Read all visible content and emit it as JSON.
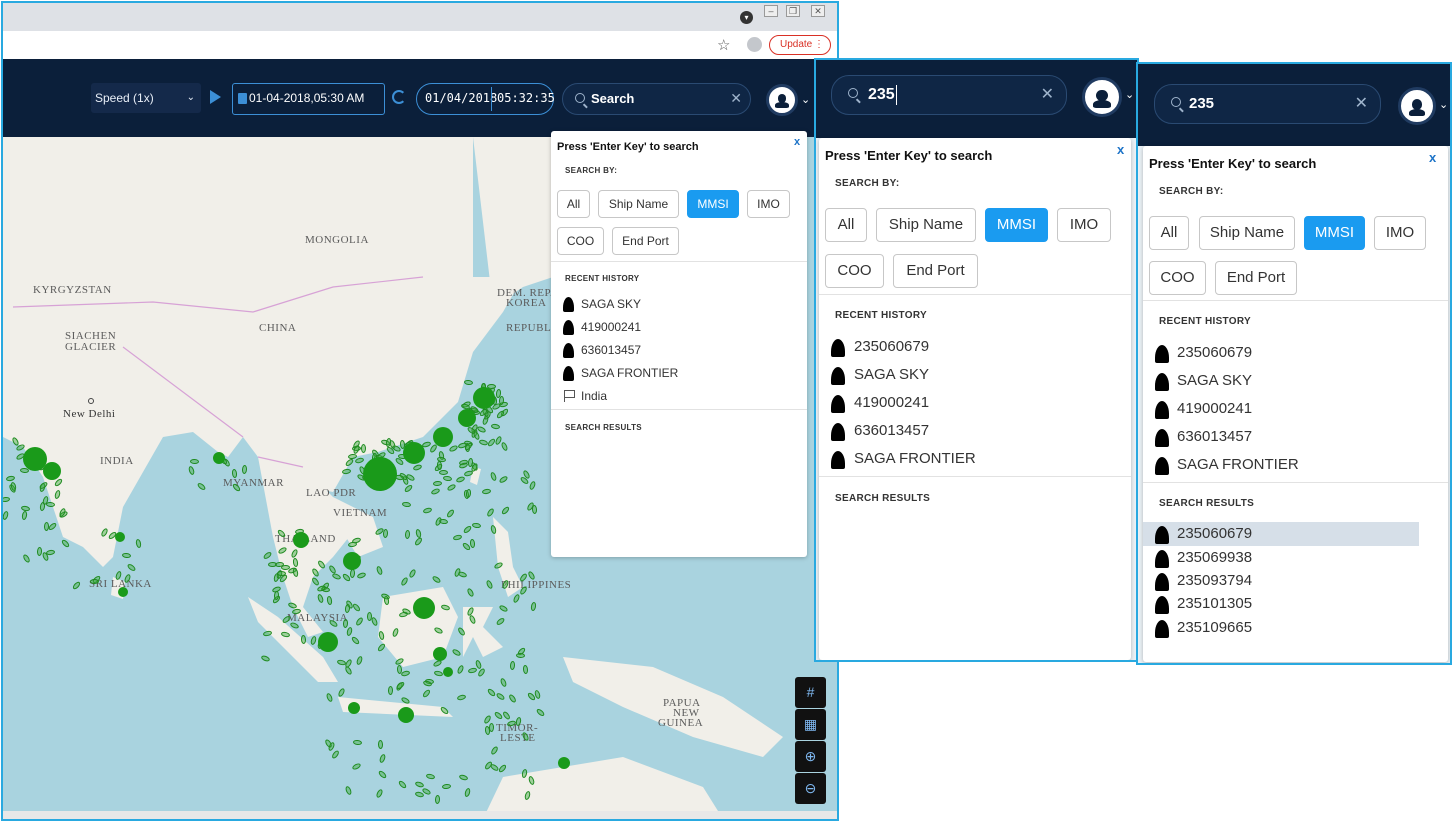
{
  "browser": {
    "update_label": "Update",
    "update_color": "#d93025",
    "icons": [
      "star-icon",
      "profile-icon",
      "tab-menu-icon",
      "minimize-icon",
      "restore-icon",
      "close-icon"
    ]
  },
  "toolbar": {
    "speed": "Speed (1x)",
    "date_value": "01-04-2018,05:30 AM",
    "clock_date": "01/04/2018",
    "clock_time": "05:32:35",
    "search_placeholder": "Search",
    "accent": "#3c8fd6",
    "bar_color": "#0b1f3a"
  },
  "map": {
    "labels": [
      "MONGOLIA",
      "KYRGYZSTAN",
      "SIACHEN",
      "GLACIER",
      "CHINA",
      "DEM. REP.",
      "KOREA",
      "REPUBLIC",
      "New Delhi",
      "INDIA",
      "MYANMAR",
      "LAO PDR",
      "VIETNAM",
      "THAILAND",
      "SRI LANKA",
      "PHILIPPINES",
      "MALAYSIA",
      "PAPUA",
      "NEW",
      "GUINEA",
      "TIMOR-",
      "LESTE"
    ],
    "controls": [
      "grid-icon",
      "map-layer-icon",
      "zoom-in-icon",
      "zoom-out-icon"
    ],
    "vessel_color": "#1a9a1a"
  },
  "panel1": {
    "prompt": "Press 'Enter Key' to search",
    "close": "x",
    "search_by": "SEARCH BY:",
    "filters": [
      "All",
      "Ship Name",
      "MMSI",
      "IMO",
      "COO",
      "End Port"
    ],
    "active_filter": "MMSI",
    "recent_title": "RECENT HISTORY",
    "recent": [
      "SAGA SKY",
      "419000241",
      "636013457",
      "SAGA FRONTIER",
      "India"
    ],
    "results_title": "SEARCH RESULTS"
  },
  "panel2": {
    "query": "235",
    "prompt": "Press 'Enter Key' to search",
    "close": "x",
    "search_by": "SEARCH BY:",
    "filters": [
      "All",
      "Ship Name",
      "MMSI",
      "IMO",
      "COO",
      "End Port"
    ],
    "active_filter": "MMSI",
    "recent_title": "RECENT HISTORY",
    "recent": [
      "235060679",
      "SAGA SKY",
      "419000241",
      "636013457",
      "SAGA FRONTIER"
    ],
    "results_title": "SEARCH RESULTS"
  },
  "panel3": {
    "query": "235",
    "prompt": "Press 'Enter Key' to search",
    "close": "x",
    "search_by": "SEARCH BY:",
    "filters": [
      "All",
      "Ship Name",
      "MMSI",
      "IMO",
      "COO",
      "End Port"
    ],
    "active_filter": "MMSI",
    "recent_title": "RECENT HISTORY",
    "recent": [
      "235060679",
      "SAGA SKY",
      "419000241",
      "636013457",
      "SAGA FRONTIER"
    ],
    "results_title": "SEARCH RESULTS",
    "results": [
      "235060679",
      "235069938",
      "235093794",
      "235101305",
      "235109665"
    ],
    "highlighted_result": "235060679"
  },
  "colors": {
    "active_chip": "#1a9bf0",
    "window_border": "#29a9e0",
    "close_x": "#1e74c8",
    "highlight_row": "#d6dfe8"
  }
}
